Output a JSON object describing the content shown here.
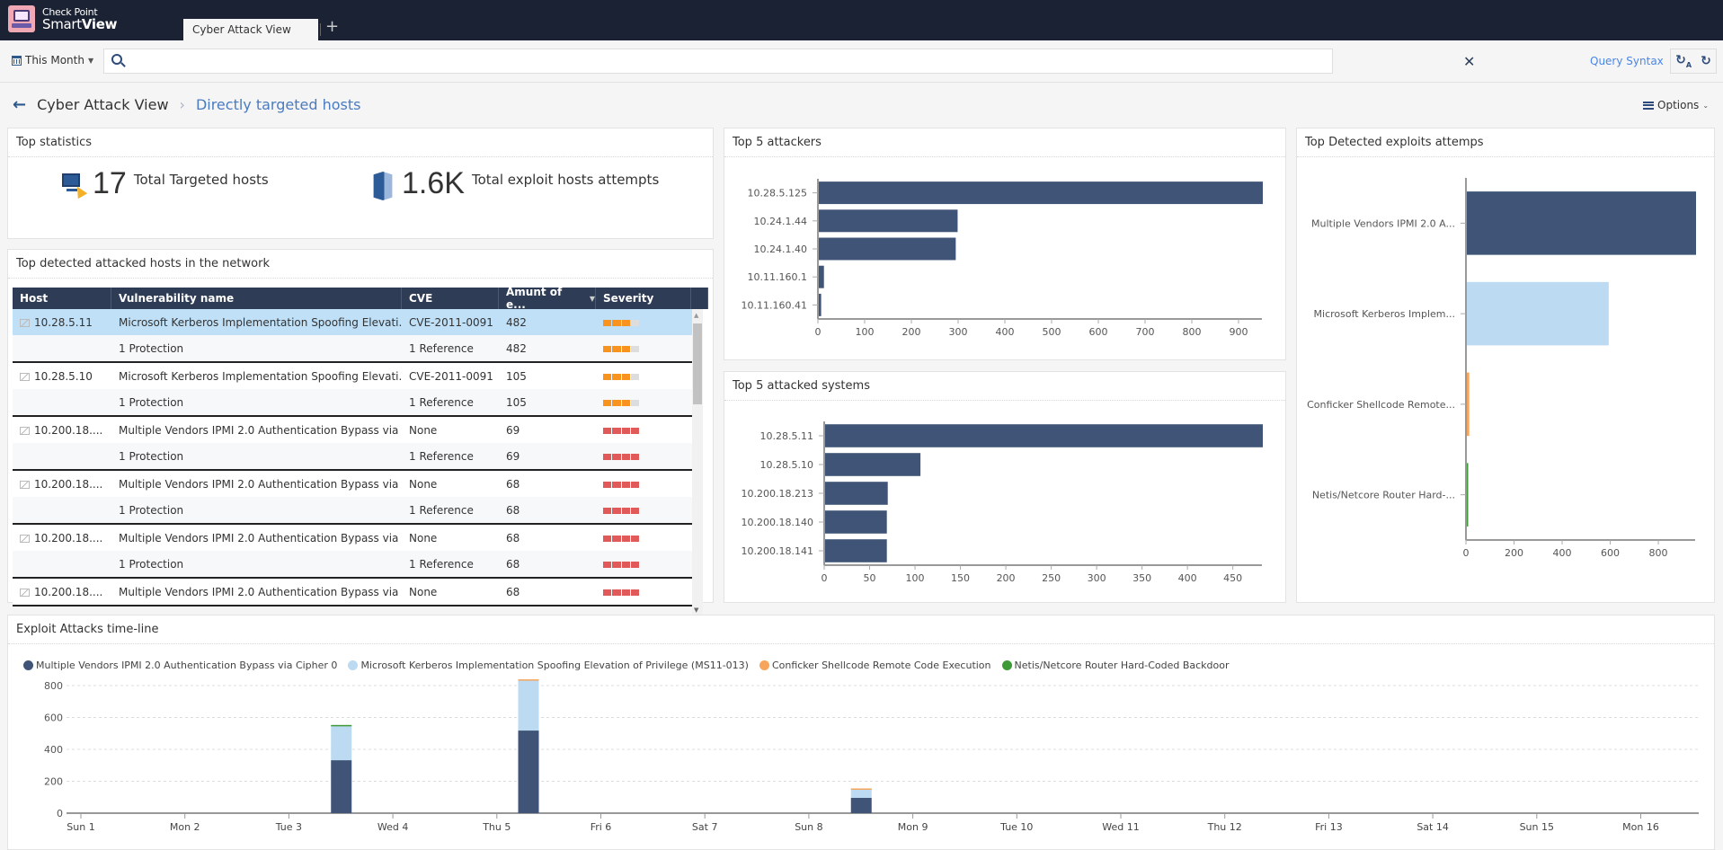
{
  "app": {
    "brand_line1": "Check Point",
    "brand_line2a": "Smart",
    "brand_line2b": "View",
    "tabs": [
      {
        "label": "Cyber Attack View",
        "active": true
      }
    ],
    "add_tab_label": "+"
  },
  "querybar": {
    "time_filter": "This Month",
    "search_value": "",
    "search_placeholder": "",
    "query_syntax_label": "Query Syntax",
    "clear_icon": "✕"
  },
  "breadcrumb": {
    "parent": "Cyber Attack View",
    "current": "Directly targeted hosts",
    "options_label": "Options"
  },
  "top_statistics": {
    "title": "Top statistics",
    "stats": [
      {
        "icon": "targeted-host-icon",
        "value": "17",
        "label": "Total Targeted hosts"
      },
      {
        "icon": "shield-icon",
        "value": "1.6K",
        "label": "Total exploit hosts attempts"
      }
    ]
  },
  "hosts_table": {
    "title": "Top detected attacked hosts in the network",
    "columns": [
      "Host",
      "Vulnerability name",
      "CVE",
      "Amunt of e...",
      "Severity"
    ],
    "colors": {
      "high": "#f7931e",
      "critical": "#e05a5a"
    },
    "groups": [
      {
        "host": "10.28.5.11",
        "vuln": "Microsoft Kerberos Implementation Spoofing Elevati...",
        "cve": "CVE-2011-0091",
        "amount": "482",
        "severity": "high",
        "severity_level": 3,
        "protection": "1 Protection",
        "reference": "1 Reference",
        "sub_amount": "482",
        "selected": true
      },
      {
        "host": "10.28.5.10",
        "vuln": "Microsoft Kerberos Implementation Spoofing Elevati...",
        "cve": "CVE-2011-0091",
        "amount": "105",
        "severity": "high",
        "severity_level": 3,
        "protection": "1 Protection",
        "reference": "1 Reference",
        "sub_amount": "105"
      },
      {
        "host": "10.200.18....",
        "vuln": "Multiple Vendors IPMI 2.0 Authentication Bypass via ...",
        "cve": "None",
        "amount": "69",
        "severity": "critical",
        "severity_level": 4,
        "protection": "1 Protection",
        "reference": "1 Reference",
        "sub_amount": "69"
      },
      {
        "host": "10.200.18....",
        "vuln": "Multiple Vendors IPMI 2.0 Authentication Bypass via ...",
        "cve": "None",
        "amount": "68",
        "severity": "critical",
        "severity_level": 4,
        "protection": "1 Protection",
        "reference": "1 Reference",
        "sub_amount": "68"
      },
      {
        "host": "10.200.18....",
        "vuln": "Multiple Vendors IPMI 2.0 Authentication Bypass via ...",
        "cve": "None",
        "amount": "68",
        "severity": "critical",
        "severity_level": 4,
        "protection": "1 Protection",
        "reference": "1 Reference",
        "sub_amount": "68"
      },
      {
        "host": "10.200.18....",
        "vuln": "Multiple Vendors IPMI 2.0 Authentication Bypass via ...",
        "cve": "None",
        "amount": "68",
        "severity": "critical",
        "severity_level": 4
      }
    ]
  },
  "chart_data": [
    {
      "id": "attackers",
      "type": "bar",
      "orientation": "horizontal",
      "title": "Top 5 attackers",
      "categories": [
        "10.28.5.125",
        "10.24.1.44",
        "10.24.1.40",
        "10.11.160.1",
        "10.11.160.41"
      ],
      "values": [
        950,
        297,
        293,
        11,
        5
      ],
      "xlim": [
        0,
        950
      ],
      "xticks": [
        0,
        100,
        200,
        300,
        400,
        500,
        600,
        700,
        800,
        900
      ],
      "colors": [
        "#3f5476"
      ]
    },
    {
      "id": "systems",
      "type": "bar",
      "orientation": "horizontal",
      "title": "Top 5 attacked systems",
      "categories": [
        "10.28.5.11",
        "10.28.5.10",
        "10.200.18.213",
        "10.200.18.140",
        "10.200.18.141"
      ],
      "values": [
        482,
        105,
        69,
        68,
        68
      ],
      "xlim": [
        0,
        482
      ],
      "xticks": [
        0,
        50,
        100,
        150,
        200,
        250,
        300,
        350,
        400,
        450
      ],
      "colors": [
        "#3f5476"
      ]
    },
    {
      "id": "exploits",
      "type": "bar",
      "orientation": "horizontal",
      "title": "Top Detected exploits attemps",
      "categories": [
        "Multiple Vendors IPMI 2.0 A...",
        "Microsoft Kerberos Implem...",
        "Conficker Shellcode Remote...",
        "Netis/Netcore Router Hard-..."
      ],
      "values": [
        953,
        590,
        10,
        4
      ],
      "xlim": [
        0,
        953
      ],
      "xticks": [
        0,
        200,
        400,
        600,
        800
      ],
      "colors": [
        "#3f5476",
        "#bcdaf1",
        "#f6a55a",
        "#3e9a37"
      ]
    },
    {
      "id": "timeline",
      "type": "bar",
      "stacked": true,
      "title": "Exploit Attacks time-line",
      "legend_position": "top-left",
      "x_ticks": [
        "Sun 1",
        "Mon 2",
        "Tue 3",
        "Wed 4",
        "Thu 5",
        "Fri 6",
        "Sat 7",
        "Sun 8",
        "Mon 9",
        "Tue 10",
        "Wed 11",
        "Thu 12",
        "Fri 13",
        "Sat 14",
        "Sun 15",
        "Mon 16"
      ],
      "x_day_range": [
        0,
        16.4
      ],
      "bar_days": [
        2.5,
        4.3,
        7.5
      ],
      "ylim": [
        0,
        800
      ],
      "yticks": [
        0,
        200,
        400,
        600,
        800
      ],
      "grid": true,
      "series": [
        {
          "name": "Multiple Vendors IPMI 2.0 Authentication Bypass via Cipher 0",
          "color": "#3f5476",
          "values": [
            332,
            518,
            96
          ]
        },
        {
          "name": "Microsoft Kerberos Implementation Spoofing Elevation of Privilege (MS11-013)",
          "color": "#bcdaf1",
          "values": [
            218,
            316,
            56
          ]
        },
        {
          "name": "Conficker Shellcode Remote Code Execution",
          "color": "#f6a55a",
          "values": [
            0,
            5,
            3
          ]
        },
        {
          "name": "Netis/Netcore Router Hard-Coded Backdoor",
          "color": "#3e9a37",
          "values": [
            3,
            0,
            0
          ]
        }
      ]
    }
  ]
}
